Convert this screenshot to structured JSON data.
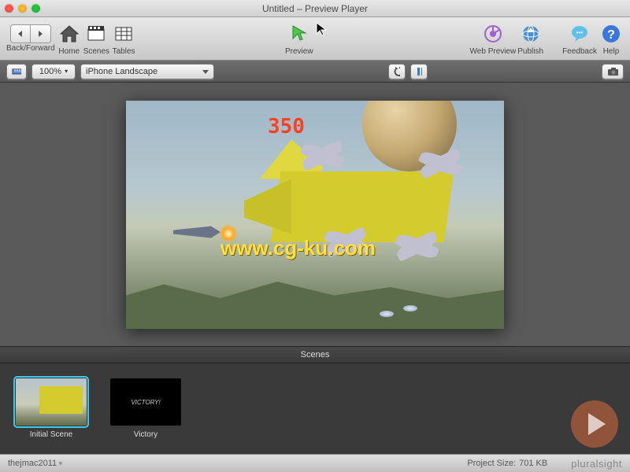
{
  "window": {
    "title": "Untitled – Preview Player"
  },
  "toolbar": {
    "back_forward": "Back/Forward",
    "home": "Home",
    "scenes": "Scenes",
    "tables": "Tables",
    "preview": "Preview",
    "web_preview": "Web Preview",
    "publish": "Publish",
    "feedback": "Feedback",
    "help": "Help"
  },
  "subbar": {
    "zoom": "100%",
    "device": "iPhone Landscape"
  },
  "game": {
    "score": "350",
    "watermark": "www.cg-ku.com"
  },
  "scenes": {
    "header": "Scenes",
    "items": [
      {
        "label": "Initial Scene",
        "selected": true
      },
      {
        "label": "Victory",
        "selected": false,
        "thumb_text": "VICTORY!"
      }
    ]
  },
  "status": {
    "user": "thejmac2011",
    "project_size_label": "Project Size:",
    "project_size_value": "701 KB",
    "brand": "pluralsight"
  }
}
